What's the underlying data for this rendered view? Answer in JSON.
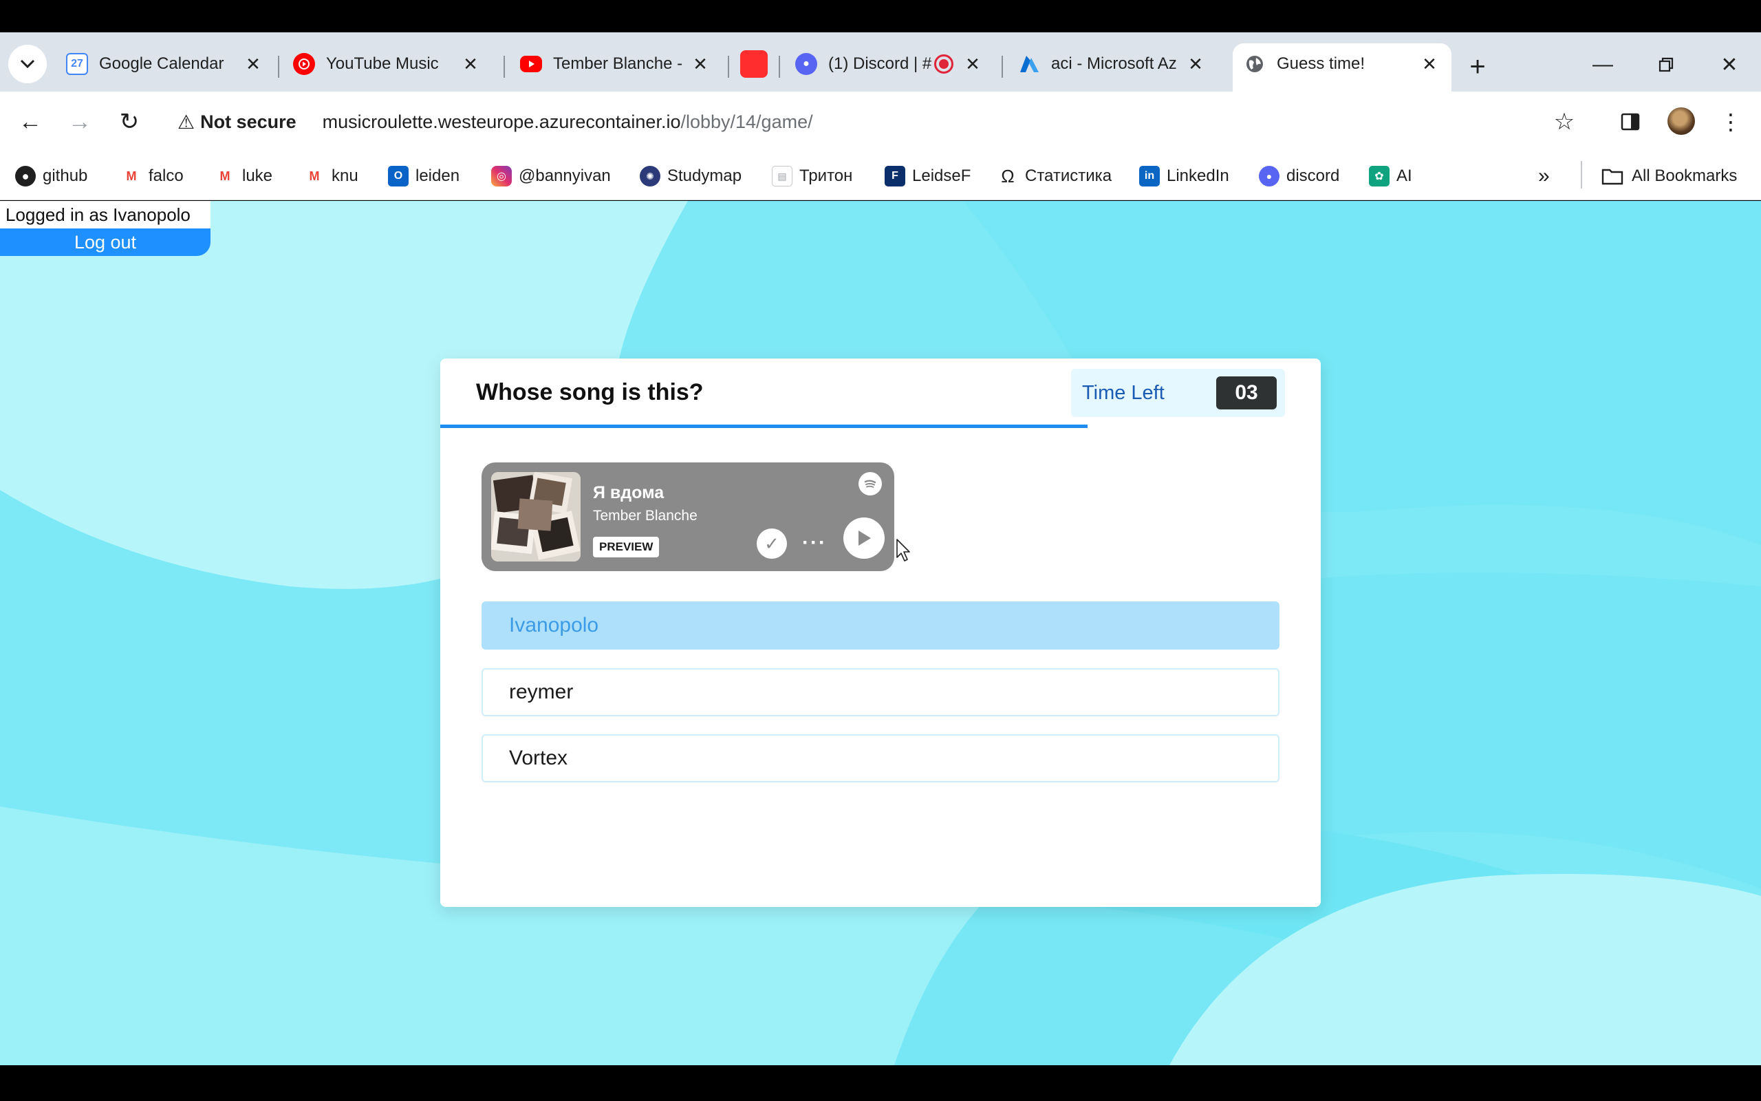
{
  "browser": {
    "tabs": [
      {
        "title": "Google Calendar",
        "icon": "google-calendar-icon",
        "badge": "27"
      },
      {
        "title": "YouTube Music",
        "icon": "youtube-music-icon"
      },
      {
        "title": "Tember Blanche -",
        "icon": "youtube-icon"
      },
      {
        "title": "",
        "icon": "red-app-icon"
      },
      {
        "title": "(1) Discord | #",
        "icon": "discord-icon",
        "badge": "1"
      },
      {
        "title": "aci - Microsoft Az",
        "icon": "azure-icon"
      },
      {
        "title": "Guess time!",
        "icon": "globe-icon",
        "active": true
      }
    ],
    "security_label": "Not secure",
    "url_host": "musicroulette.westeurope.azurecontainer.io",
    "url_path": "/lobby/14/game/",
    "bookmarks": [
      {
        "label": "github",
        "icon": "github-icon"
      },
      {
        "label": "falco",
        "icon": "gmail-icon"
      },
      {
        "label": "luke",
        "icon": "gmail-icon"
      },
      {
        "label": "knu",
        "icon": "gmail-icon"
      },
      {
        "label": "leiden",
        "icon": "outlook-icon"
      },
      {
        "label": "@bannyivan",
        "icon": "instagram-icon"
      },
      {
        "label": "Studymap",
        "icon": "university-seal-icon"
      },
      {
        "label": "Тритон",
        "icon": "document-icon"
      },
      {
        "label": "LeidseF",
        "icon": "leidsef-icon"
      },
      {
        "label": "Статистика",
        "icon": "omega-icon"
      },
      {
        "label": "LinkedIn",
        "icon": "linkedin-icon"
      },
      {
        "label": "discord",
        "icon": "discord-icon"
      },
      {
        "label": "AI",
        "icon": "openai-icon"
      }
    ],
    "all_bookmarks_label": "All Bookmarks"
  },
  "session": {
    "logged_in_text": "Logged in as Ivanopolo",
    "logout_label": "Log out"
  },
  "game": {
    "question": "Whose song is this?",
    "time_left_label": "Time Left",
    "time_left_value": "03",
    "time_progress": 0.735,
    "track": {
      "title": "Я вдома",
      "artist": "Tember Blanche",
      "preview_label": "PREVIEW"
    },
    "answers": [
      {
        "label": "Ivanopolo",
        "selected": true
      },
      {
        "label": "reymer",
        "selected": false
      },
      {
        "label": "Vortex",
        "selected": false
      }
    ]
  },
  "colors": {
    "page_bg": "#7ee9f6",
    "accent": "#1e90ff",
    "selected_answer": "#aee0fb",
    "player_bg": "#8b8a8a"
  }
}
